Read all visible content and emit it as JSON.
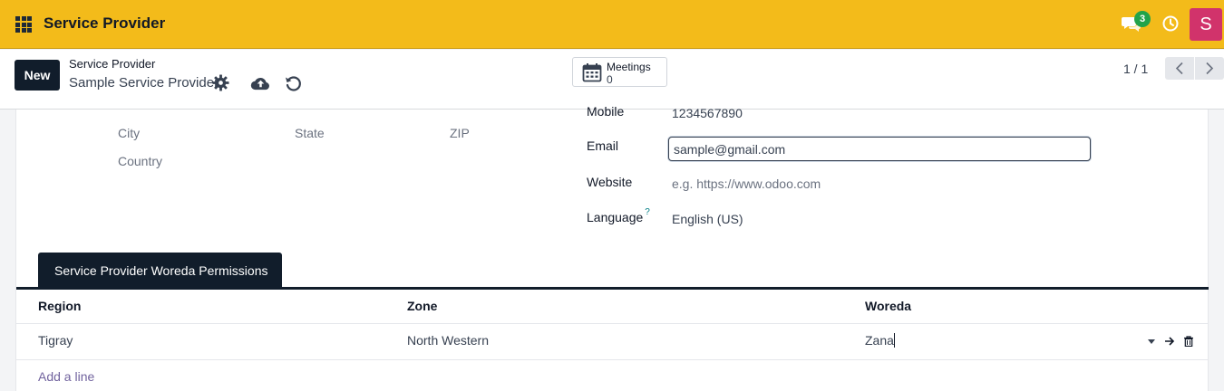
{
  "navbar": {
    "app_title": "Service Provider",
    "message_count": "3",
    "user_initial": "S"
  },
  "control_panel": {
    "new_label": "New",
    "breadcrumb_parent": "Service Provider",
    "breadcrumb_current": "Sample Service Provider",
    "meetings_label": "Meetings",
    "meetings_count": "0",
    "pager_value": "1 / 1"
  },
  "address": {
    "city_placeholder": "City",
    "state_placeholder": "State",
    "zip_placeholder": "ZIP",
    "country_placeholder": "Country"
  },
  "contact": {
    "mobile_label": "Mobile",
    "mobile_value": "1234567890",
    "email_label": "Email",
    "email_value": "sample@gmail.com",
    "website_label": "Website",
    "website_placeholder": "e.g. https://www.odoo.com",
    "language_label": "Language",
    "language_help": "?",
    "language_value": "English (US)"
  },
  "tab": {
    "label": "Service Provider Woreda Permissions"
  },
  "table": {
    "columns": [
      "Region",
      "Zone",
      "Woreda"
    ],
    "rows": [
      {
        "region": "Tigray",
        "zone": "North Western",
        "woreda": "Zana"
      }
    ],
    "add_line_label": "Add a line"
  },
  "colors": {
    "navbar": "#f3bb1a",
    "primary_dark": "#111d2b",
    "badge": "#22a34a",
    "avatar": "#d1336b",
    "link": "#71639e"
  }
}
